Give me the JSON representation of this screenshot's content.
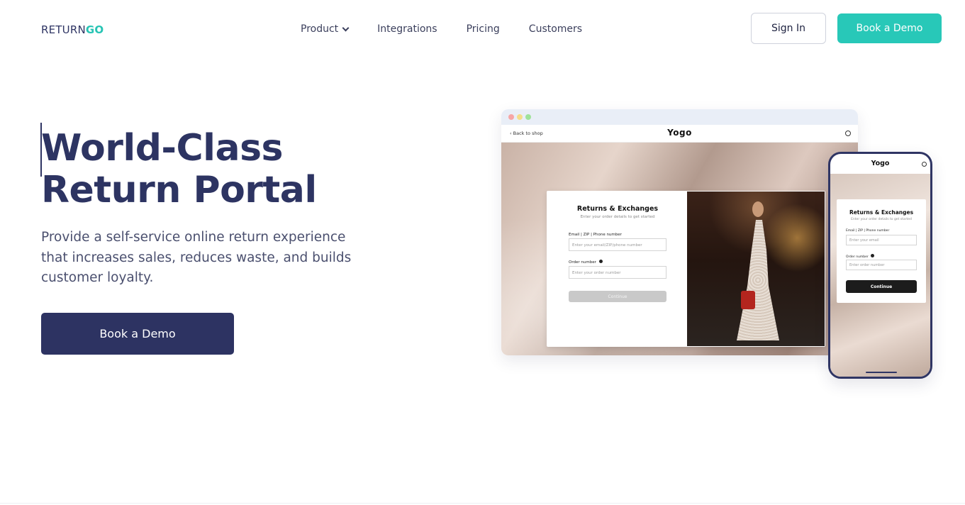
{
  "logo": {
    "return": "RETURN",
    "go": "GO"
  },
  "nav": {
    "links": [
      "Product",
      "Integrations",
      "Pricing",
      "Customers"
    ],
    "sign_in": "Sign In",
    "book_demo": "Book a Demo"
  },
  "hero": {
    "title_line1": "World-Class",
    "title_line2": "Return Portal",
    "subtitle": "Provide a self-service online return experience that increases sales, reduces waste, and builds customer loyalty.",
    "cta": "Book a Demo"
  },
  "desktop_mock": {
    "back_link": "‹ Back to shop",
    "brand": "Yogo",
    "card_title": "Returns & Exchanges",
    "card_hint": "Enter your order details to get started",
    "email_label": "Email | ZIP | Phone number",
    "email_placeholder": "Enter your email/ZIP/phone number",
    "order_label": "Order number",
    "order_placeholder": "Enter your order number",
    "continue": "Continue"
  },
  "phone_mock": {
    "brand": "Yogo",
    "card_title": "Returns & Exchanges",
    "card_hint": "Enter your order details to get started",
    "email_label": "Email | ZIP | Phone number",
    "email_placeholder": "Enter your email",
    "order_label": "Order number",
    "order_placeholder": "Enter order number",
    "continue": "Continue"
  },
  "colors": {
    "navy": "#2d3362",
    "teal": "#28c8b8",
    "text": "#4a4f6e"
  }
}
